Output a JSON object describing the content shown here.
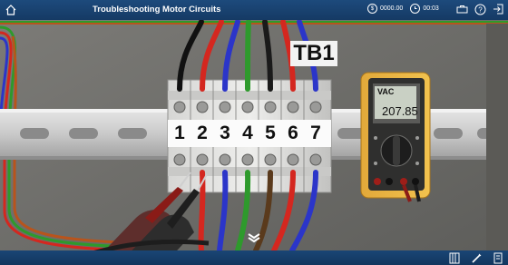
{
  "header": {
    "title": "Troubleshooting Motor Circuits",
    "score": "0000.00",
    "timer": "00:03",
    "icons": [
      "home-icon",
      "dollar-icon",
      "clock-icon",
      "toolbox-icon",
      "help-icon",
      "exit-icon"
    ]
  },
  "terminal_block": {
    "label": "TB1",
    "terminals": [
      "1",
      "2",
      "3",
      "4",
      "5",
      "6",
      "7"
    ],
    "top_wire_colors": [
      "#111111",
      "#d4271f",
      "#2b35c9",
      "#2e9a2c",
      "#1a1a1a",
      "#d4271f",
      "#2b35c9"
    ]
  },
  "multimeter": {
    "unit": "VAC",
    "reading": "207.85"
  },
  "footer": {
    "icons": [
      "panel-icon",
      "probe-icon",
      "notes-icon"
    ]
  }
}
